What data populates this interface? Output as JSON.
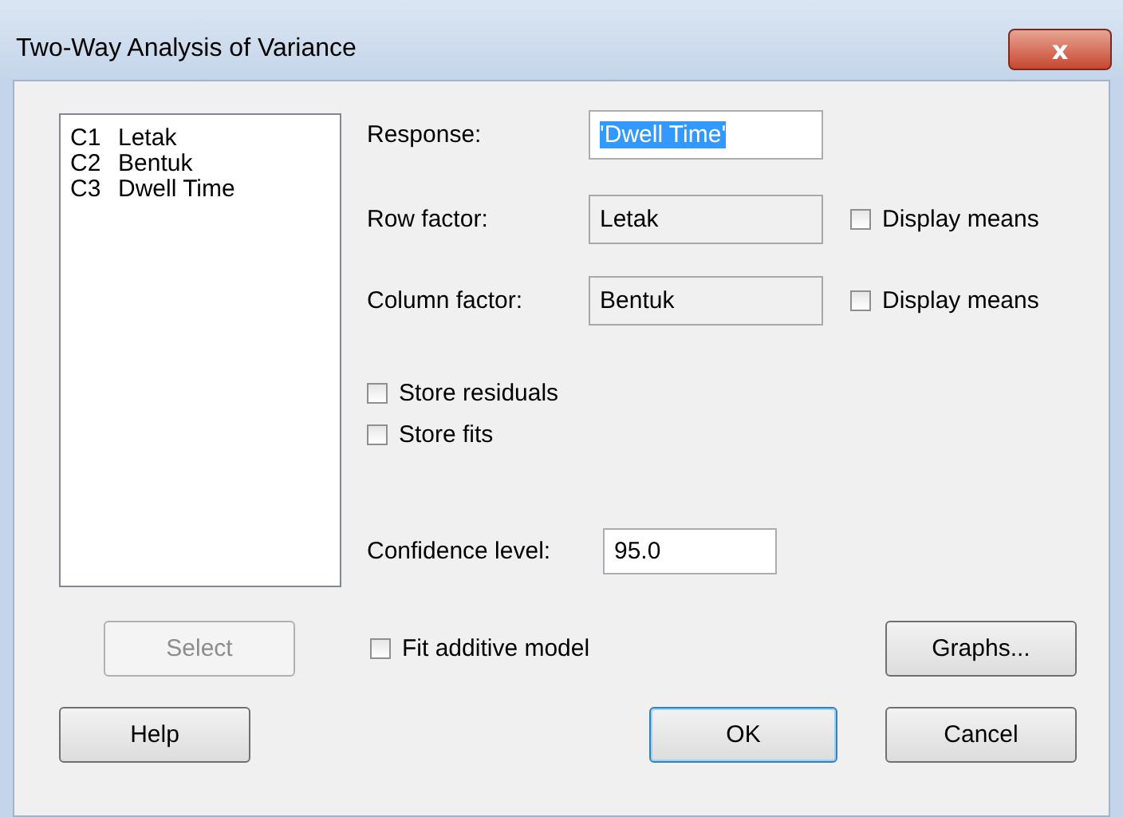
{
  "window": {
    "title": "Two-Way Analysis of Variance",
    "close": "x"
  },
  "variables": [
    {
      "column": "C1",
      "name": "Letak"
    },
    {
      "column": "C2",
      "name": "Bentuk"
    },
    {
      "column": "C3",
      "name": "Dwell Time"
    }
  ],
  "response": {
    "label": "Response:",
    "value": "'Dwell Time'",
    "text_selected": true
  },
  "factors": [
    {
      "label": "Row factor:",
      "value": "Letak",
      "readonly": true,
      "option": {
        "label": "Display means",
        "checked": false
      }
    },
    {
      "label": "Column factor:",
      "value": "Bentuk",
      "readonly": true,
      "option": {
        "label": "Display means",
        "checked": false
      }
    }
  ],
  "store_options": [
    {
      "label": "Store residuals",
      "checked": false
    },
    {
      "label": "Store fits",
      "checked": false
    }
  ],
  "confidence": {
    "label": "Confidence level:",
    "value": "95.0"
  },
  "select_button": {
    "label": "Select",
    "disabled": true
  },
  "fit_additive": {
    "label": "Fit additive model",
    "checked": false
  },
  "buttons": [
    {
      "label": "Graphs...",
      "default": false
    },
    {
      "label": "Help",
      "default": false
    },
    {
      "label": "OK",
      "default": true
    },
    {
      "label": "Cancel",
      "default": false
    }
  ]
}
